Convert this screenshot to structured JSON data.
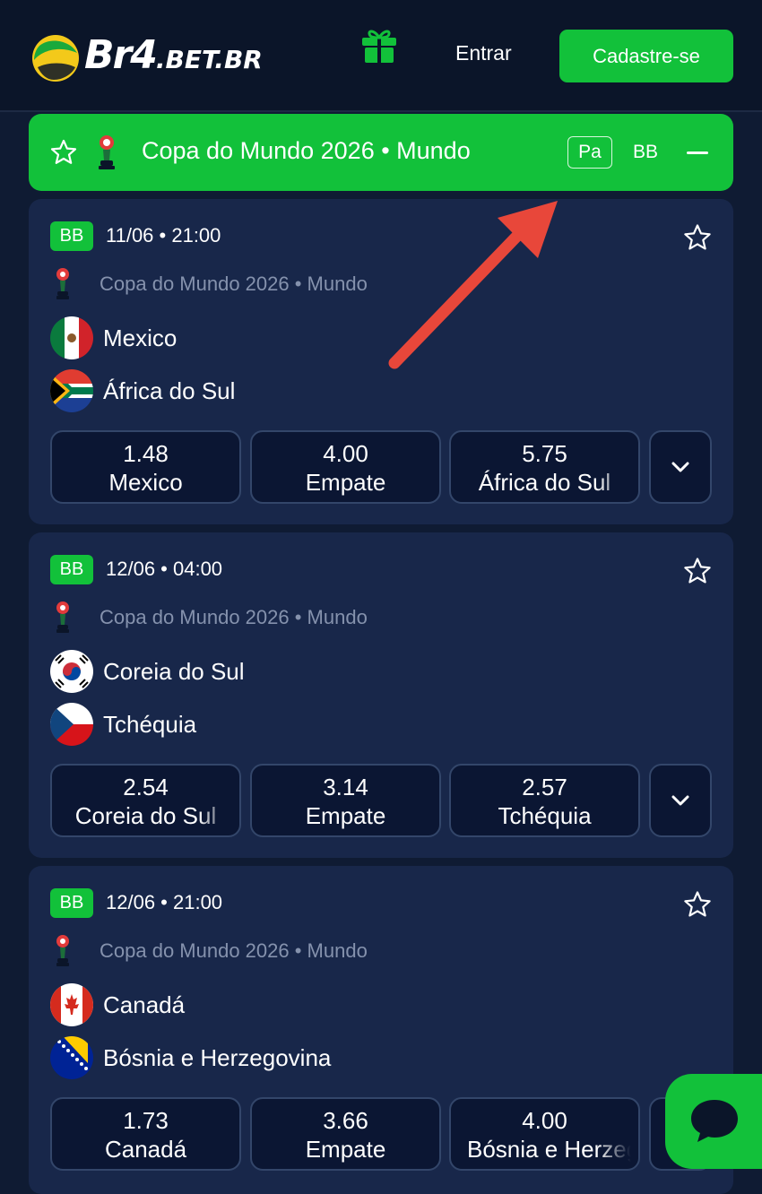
{
  "header": {
    "logo_main": "Br4",
    "logo_suffix": ".BET.BR",
    "login_label": "Entrar",
    "register_label": "Cadastre-se"
  },
  "tournament": {
    "title": "Copa do Mundo 2026 • Mundo",
    "chip_label": "Pa",
    "bb_label": "BB"
  },
  "matches": [
    {
      "badge": "BB",
      "datetime": "11/06 • 21:00",
      "league": "Copa do Mundo 2026 • Mundo",
      "home": "Mexico",
      "away": "África do Sul",
      "odds": [
        {
          "value": "1.48",
          "label": "Mexico"
        },
        {
          "value": "4.00",
          "label": "Empate"
        },
        {
          "value": "5.75",
          "label": "África do Sul"
        }
      ]
    },
    {
      "badge": "BB",
      "datetime": "12/06 • 04:00",
      "league": "Copa do Mundo 2026 • Mundo",
      "home": "Coreia do Sul",
      "away": "Tchéquia",
      "odds": [
        {
          "value": "2.54",
          "label": "Coreia do Sul"
        },
        {
          "value": "3.14",
          "label": "Empate"
        },
        {
          "value": "2.57",
          "label": "Tchéquia"
        }
      ]
    },
    {
      "badge": "BB",
      "datetime": "12/06 • 21:00",
      "league": "Copa do Mundo 2026 • Mundo",
      "home": "Canadá",
      "away": "Bósnia e Herzegovina",
      "odds": [
        {
          "value": "1.73",
          "label": "Canadá"
        },
        {
          "value": "3.66",
          "label": "Empate"
        },
        {
          "value": "4.00",
          "label": "Bósnia e Herzegovina"
        }
      ]
    }
  ],
  "colors": {
    "accent": "#12c13a",
    "background": "#0f1b33",
    "card": "#18274a",
    "annotation_arrow": "#e8473a"
  },
  "icons": [
    "logo-ball-icon",
    "gift-icon",
    "star-icon",
    "trophy-icon",
    "chevron-down-icon",
    "chat-icon",
    "minus-icon"
  ]
}
